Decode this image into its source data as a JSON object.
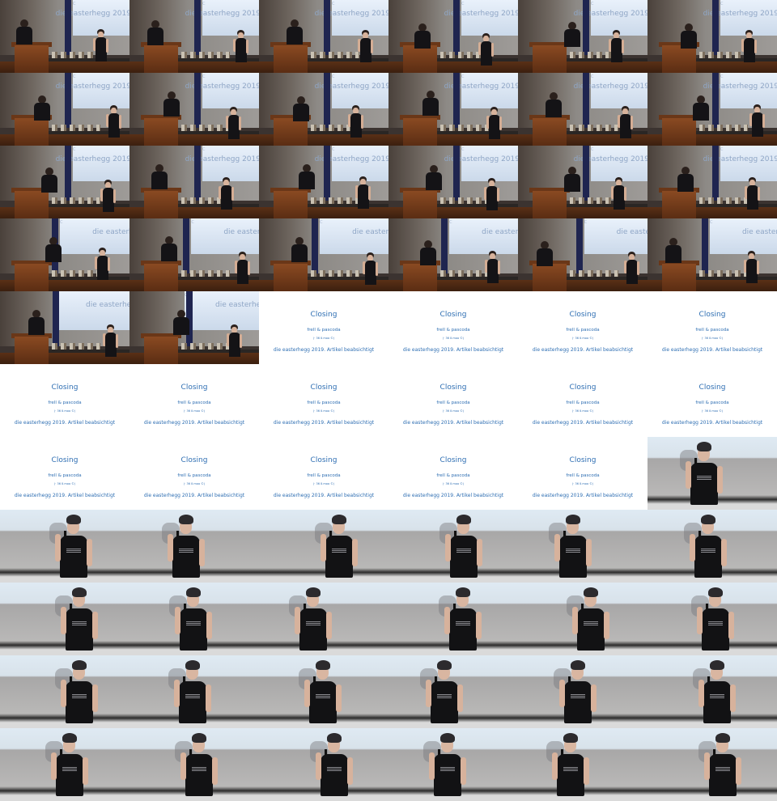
{
  "hall_screen_text": "die easterhegg 2019",
  "slide": {
    "title": "Closing",
    "authors": "frell & pascoda",
    "contact": "(· 36 ß moo ©)",
    "event": "die easterhegg 2019. Artikel beabsichtigt"
  },
  "grid": {
    "columns": 6,
    "rows": 11,
    "frames": [
      "hall",
      "hall",
      "hall",
      "hall",
      "hall",
      "hall",
      "hall",
      "hall",
      "hall",
      "hall",
      "hall",
      "hall",
      "hall",
      "hall",
      "hall",
      "hall",
      "hall",
      "hall",
      "hall",
      "hall",
      "hall",
      "hall",
      "hall",
      "hall",
      "hall",
      "hall",
      "slide",
      "slide",
      "slide",
      "slide",
      "slide",
      "slide",
      "slide",
      "slide",
      "slide",
      "slide",
      "slide",
      "slide",
      "slide",
      "slide",
      "slide",
      "close",
      "close",
      "close",
      "close",
      "close",
      "close",
      "close",
      "close",
      "close",
      "close",
      "close",
      "close",
      "close",
      "close",
      "close",
      "close",
      "close",
      "close",
      "close",
      "close",
      "close",
      "close",
      "close",
      "close",
      "close"
    ]
  },
  "colors": {
    "slide_text": "#2f6fb3",
    "curtain": "#1f2550",
    "podium": "#8a4a22"
  }
}
